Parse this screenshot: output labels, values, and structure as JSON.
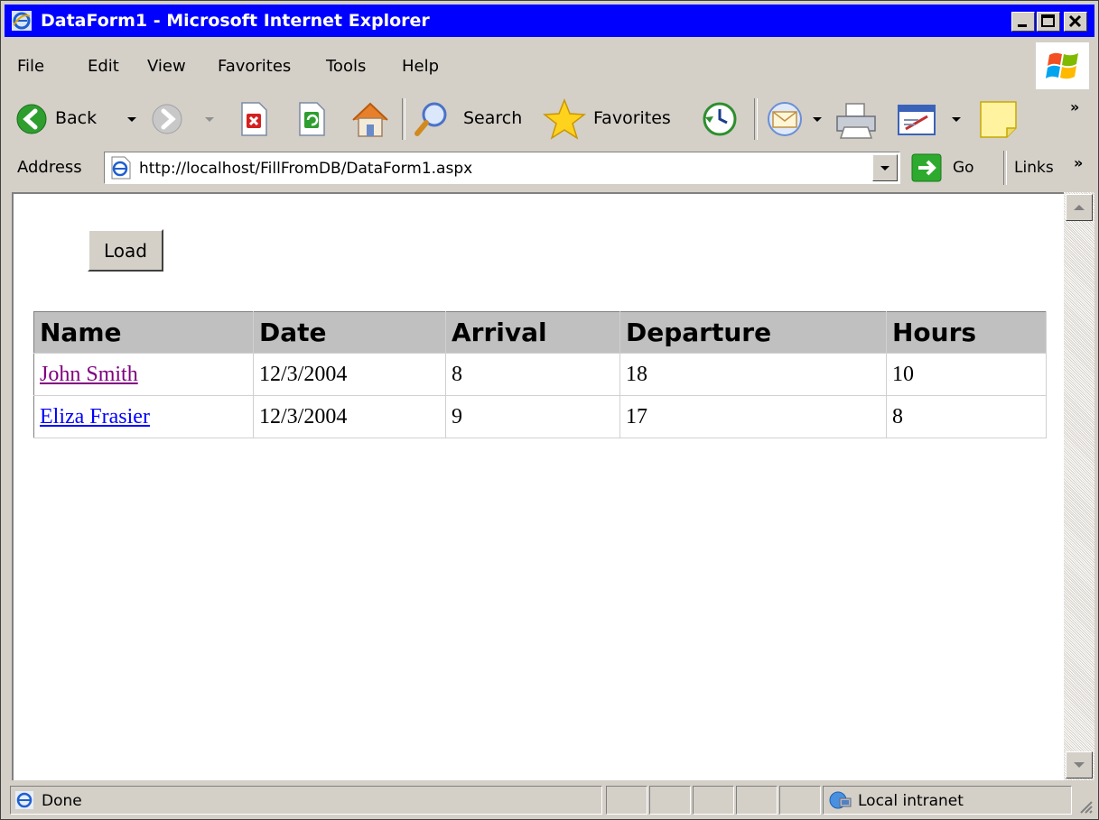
{
  "window": {
    "title": "DataForm1 - Microsoft Internet Explorer"
  },
  "menu": {
    "items": [
      "File",
      "Edit",
      "View",
      "Favorites",
      "Tools",
      "Help"
    ]
  },
  "toolbar": {
    "back_label": "Back",
    "search_label": "Search",
    "favorites_label": "Favorites",
    "overflow": "»"
  },
  "address": {
    "label": "Address",
    "url": "http://localhost/FillFromDB/DataForm1.aspx",
    "go_label": "Go",
    "links_label": "Links",
    "links_overflow": "»"
  },
  "page": {
    "load_button": "Load",
    "table": {
      "headers": [
        "Name",
        "Date",
        "Arrival",
        "Departure",
        "Hours"
      ],
      "rows": [
        [
          "John Smith",
          "12/3/2004",
          "8",
          "18",
          "10"
        ],
        [
          "Eliza Frasier",
          "12/3/2004",
          "9",
          "17",
          "8"
        ]
      ],
      "link_colors": [
        "#800080",
        "#0000ff"
      ]
    }
  },
  "status": {
    "text": "Done",
    "zone": "Local intranet"
  }
}
